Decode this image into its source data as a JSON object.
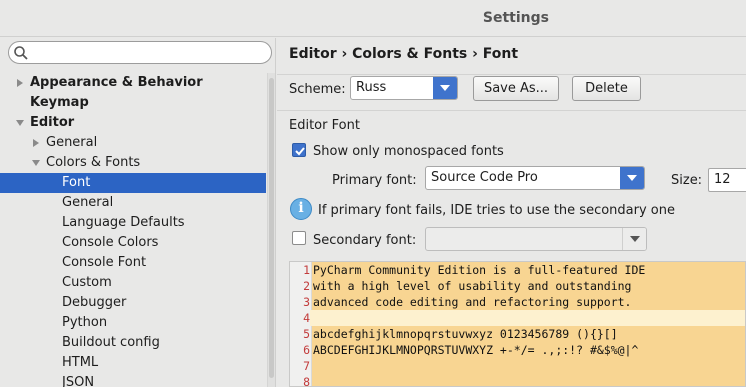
{
  "window": {
    "title": "Settings"
  },
  "sidebar": {
    "search_placeholder": "",
    "items": [
      {
        "label": "Appearance & Behavior",
        "level": 0,
        "arrow": "right",
        "bold": true
      },
      {
        "label": "Keymap",
        "level": 0,
        "arrow": "",
        "bold": true
      },
      {
        "label": "Editor",
        "level": 0,
        "arrow": "down",
        "bold": true
      },
      {
        "label": "General",
        "level": 1,
        "arrow": "right",
        "bold": false
      },
      {
        "label": "Colors & Fonts",
        "level": 1,
        "arrow": "down",
        "bold": false
      },
      {
        "label": "Font",
        "level": 2,
        "arrow": "",
        "bold": false,
        "selected": true
      },
      {
        "label": "General",
        "level": 2,
        "arrow": "",
        "bold": false
      },
      {
        "label": "Language Defaults",
        "level": 2,
        "arrow": "",
        "bold": false
      },
      {
        "label": "Console Colors",
        "level": 2,
        "arrow": "",
        "bold": false
      },
      {
        "label": "Console Font",
        "level": 2,
        "arrow": "",
        "bold": false
      },
      {
        "label": "Custom",
        "level": 2,
        "arrow": "",
        "bold": false
      },
      {
        "label": "Debugger",
        "level": 2,
        "arrow": "",
        "bold": false
      },
      {
        "label": "Python",
        "level": 2,
        "arrow": "",
        "bold": false
      },
      {
        "label": "Buildout config",
        "level": 2,
        "arrow": "",
        "bold": false
      },
      {
        "label": "HTML",
        "level": 2,
        "arrow": "",
        "bold": false
      },
      {
        "label": "JSON",
        "level": 2,
        "arrow": "",
        "bold": false
      }
    ]
  },
  "main": {
    "breadcrumb": "Editor › Colors & Fonts › Font",
    "scheme_label": "Scheme:",
    "scheme_value": "Russ",
    "save_as_label": "Save As...",
    "delete_label": "Delete",
    "section_label": "Editor Font",
    "show_mono_label": "Show only monospaced fonts",
    "show_mono_checked": true,
    "primary_font_label": "Primary font:",
    "primary_font_value": "Source Code Pro",
    "size_label": "Size:",
    "size_value": "12",
    "info_text": "If primary font fails, IDE tries to use the secondary one",
    "secondary_font_label": "Secondary font:",
    "secondary_font_checked": false,
    "secondary_font_value": ""
  },
  "preview": {
    "lines": [
      {
        "num": "1",
        "text": "PyCharm Community Edition is a full-featured IDE"
      },
      {
        "num": "2",
        "text": "with a high level of usability and outstanding"
      },
      {
        "num": "3",
        "text": "advanced code editing and refactoring support."
      },
      {
        "num": "4",
        "text": ""
      },
      {
        "num": "5",
        "text": "abcdefghijklmnopqrstuvwxyz 0123456789 (){}[]"
      },
      {
        "num": "6",
        "text": "ABCDEFGHIJKLMNOPQRSTUVWXYZ +-*/= .,;:!? #&$%@|^"
      },
      {
        "num": "7",
        "text": ""
      },
      {
        "num": "8",
        "text": ""
      }
    ],
    "current_line_index": 3
  },
  "colors": {
    "selection": "#2c64c4",
    "preview_background": "#f8d592",
    "line_number": "#c23b3b"
  }
}
